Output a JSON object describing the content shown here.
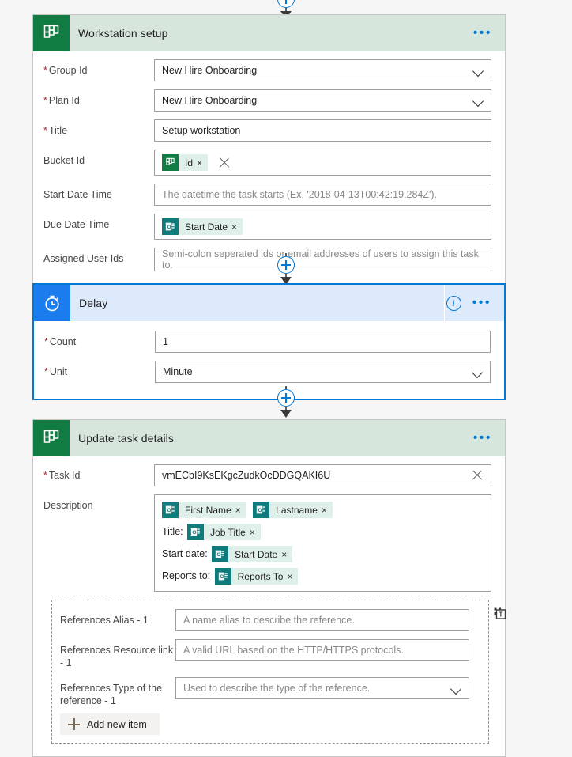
{
  "colors": {
    "planner_green": "#107c41",
    "planner_header_bg": "#d7e6dd",
    "delay_blue": "#1b7ced",
    "delay_header_bg": "#dceafb",
    "accent_blue": "#0078d4",
    "required_red": "#a4262c",
    "token_bg": "#dff0ea",
    "forms_teal": "#0f7b7b",
    "page_bg": "#f5f5f5"
  },
  "connectors": {
    "top": {
      "icon": "arrow-down-icon"
    },
    "between_1_2": {
      "icon": "plus-circle-icon",
      "label": "+"
    },
    "between_2_3": {
      "icon": "plus-circle-icon",
      "label": "+"
    }
  },
  "cards": [
    {
      "id": "workstation-setup",
      "title": "Workstation setup",
      "icon": "planner-icon",
      "menu": "•••",
      "fields": [
        {
          "label": "Group Id",
          "required": true,
          "type": "dropdown",
          "value": "New Hire Onboarding",
          "placeholder": ""
        },
        {
          "label": "Plan Id",
          "required": true,
          "type": "dropdown",
          "value": "New Hire Onboarding",
          "placeholder": ""
        },
        {
          "label": "Title",
          "required": true,
          "type": "text",
          "value": "Setup workstation",
          "placeholder": ""
        },
        {
          "label": "Bucket Id",
          "required": false,
          "type": "token",
          "clearable": true,
          "tokens": [
            {
              "icon": "planner-icon",
              "label": "Id",
              "remove": "×"
            }
          ]
        },
        {
          "label": "Start Date Time",
          "required": false,
          "type": "text",
          "value": "",
          "placeholder": "The datetime the task starts (Ex. '2018-04-13T00:42:19.284Z')."
        },
        {
          "label": "Due Date Time",
          "required": false,
          "type": "token",
          "clearable": false,
          "tokens": [
            {
              "icon": "forms-icon",
              "label": "Start Date",
              "remove": "×"
            }
          ]
        },
        {
          "label": "Assigned User Ids",
          "required": false,
          "type": "text",
          "value": "",
          "placeholder": "Semi-colon seperated ids or email addresses of users to assign this task to."
        }
      ]
    },
    {
      "id": "delay",
      "title": "Delay",
      "icon": "timer-icon",
      "info": "info-icon",
      "menu": "•••",
      "selected": true,
      "fields": [
        {
          "label": "Count",
          "required": true,
          "type": "text",
          "value": "1",
          "placeholder": ""
        },
        {
          "label": "Unit",
          "required": true,
          "type": "dropdown",
          "value": "Minute",
          "placeholder": ""
        }
      ]
    },
    {
      "id": "update-task-details",
      "title": "Update task details",
      "icon": "planner-icon",
      "menu": "•••",
      "fields": [
        {
          "label": "Task Id",
          "required": true,
          "type": "text",
          "value": "vmECbI9KsEKgcZudkOcDDGQAKI6U",
          "clearable": true,
          "placeholder": ""
        }
      ],
      "description": {
        "label": "Description",
        "lines": [
          {
            "lead": "",
            "tokens": [
              {
                "icon": "forms-icon",
                "label": "First Name",
                "remove": "×"
              },
              {
                "icon": "forms-icon",
                "label": "Lastname",
                "remove": "×"
              }
            ]
          },
          {
            "lead": "Title:",
            "tokens": [
              {
                "icon": "forms-icon",
                "label": "Job Title",
                "remove": "×"
              }
            ]
          },
          {
            "lead": "Start date:",
            "tokens": [
              {
                "icon": "forms-icon",
                "label": "Start Date",
                "remove": "×"
              }
            ]
          },
          {
            "lead": "Reports to:",
            "tokens": [
              {
                "icon": "forms-icon",
                "label": "Reports To",
                "remove": "×"
              }
            ]
          }
        ]
      },
      "references": {
        "delete_icon": "delete-item-icon",
        "rows": [
          {
            "label": "References Alias - 1",
            "type": "text",
            "value": "",
            "placeholder": "A name alias to describe the reference."
          },
          {
            "label": "References Resource link - 1",
            "type": "text",
            "value": "",
            "placeholder": "A valid URL based on the HTTP/HTTPS protocols."
          },
          {
            "label": "References Type of the reference - 1",
            "type": "dropdown",
            "value": "",
            "placeholder": "Used to describe the type of the reference."
          }
        ],
        "add_label": "Add new item"
      }
    }
  ]
}
